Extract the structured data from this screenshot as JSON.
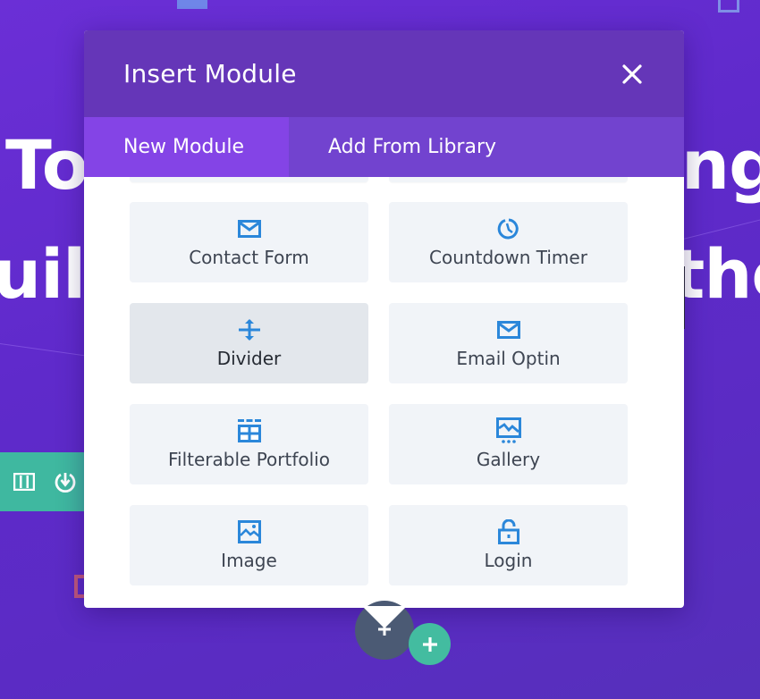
{
  "background": {
    "hero_line_1_left": "To",
    "hero_line_1_right": "nge",
    "hero_line_2_left": "uil",
    "hero_line_2_right": "the"
  },
  "modal": {
    "title": "Insert Module",
    "close_icon": "close-icon",
    "tabs": [
      {
        "label": "New Module",
        "active": true
      },
      {
        "label": "Add From Library",
        "active": false
      }
    ],
    "modules": [
      {
        "label": "Contact Form",
        "icon": "envelope-icon",
        "hover": false
      },
      {
        "label": "Countdown Timer",
        "icon": "timer-icon",
        "hover": false
      },
      {
        "label": "Divider",
        "icon": "divider-icon",
        "hover": true
      },
      {
        "label": "Email Optin",
        "icon": "envelope-icon",
        "hover": false
      },
      {
        "label": "Filterable Portfolio",
        "icon": "filterable-portfolio-icon",
        "hover": false
      },
      {
        "label": "Gallery",
        "icon": "gallery-icon",
        "hover": false
      },
      {
        "label": "Image",
        "icon": "image-icon",
        "hover": false
      },
      {
        "label": "Login",
        "icon": "unlock-icon",
        "hover": false
      }
    ]
  },
  "colors": {
    "header": "#6536b8",
    "tabs_bar": "#7243cf",
    "active_tab": "#8444e6",
    "icon_blue": "#2b87da",
    "teal": "#43bca0",
    "dark_button": "#4b5a74"
  }
}
